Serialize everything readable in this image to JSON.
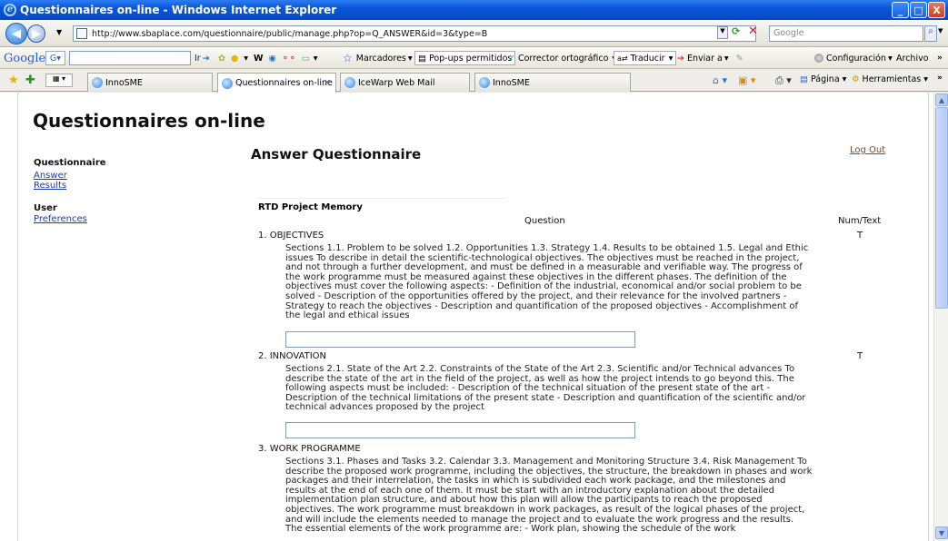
{
  "window": {
    "title": "Questionnaires on-line - Windows Internet Explorer",
    "minimize": "_",
    "maximize": "□",
    "close": "X"
  },
  "address": {
    "url": "http://www.sbaplace.com/questionnaire/public/manage.php?op=Q_ANSWER&id=3&type=B",
    "search_placeholder": "Google"
  },
  "google_toolbar": {
    "logo": "Google",
    "go": "Ir",
    "bookmarks": "Marcadores",
    "popups": "Pop-ups permitidos",
    "spell": "Corrector ortográfico",
    "translate": "Traducir",
    "send": "Enviar a",
    "settings": "Configuración",
    "archive": "Archivo"
  },
  "tabs": [
    {
      "label": "InnoSME"
    },
    {
      "label": "Questionnaires on-line"
    },
    {
      "label": "IceWarp Web Mail"
    },
    {
      "label": "InnoSME"
    }
  ],
  "tab_tools": {
    "page": "Página",
    "tools": "Herramientas"
  },
  "page": {
    "title": "Questionnaires on-line",
    "logout": "Log Out",
    "sidebar": {
      "questionnaire_head": "Questionnaire",
      "answer": "Answer",
      "results": "Results",
      "user_head": "User",
      "preferences": "Preferences"
    },
    "heading": "Answer Questionnaire",
    "section": "RTD Project Memory",
    "col_question": "Question",
    "col_type": "Num/Text",
    "questions": [
      {
        "title": "1. OBJECTIVES",
        "type": "T",
        "desc": "Sections 1.1. Problem to be solved 1.2. Opportunities 1.3. Strategy 1.4. Results to be obtained 1.5. Legal and Ethic issues To describe in detail the scientific-technological objectives. The objectives must be reached in the project, and not through a further development, and must be defined in a measurable and verifiable way. The progress of the work programme must be measured against these objectives in the different phases. The definition of the objectives must cover the following aspects: - Definition of the industrial, economical and/or social problem to be solved - Description of the opportunities offered by the project, and their relevance for the involved partners - Strategy to reach the objectives - Description and quantification of the proposed objectives - Accomplishment of the legal and ethical issues"
      },
      {
        "title": "2. INNOVATION",
        "type": "T",
        "desc": "Sections 2.1. State of the Art 2.2. Constraints of the State of the Art 2.3. Scientific and/or Technical advances To describe the state of the art in the field of the project, as well as how the project intends to go beyond this. The following aspects must be included: - Description of the technical situation of the present state of the art - Description of the technical limitations of the present state - Description and quantification of the scientific and/or technical advances proposed by the project"
      },
      {
        "title": "3. WORK PROGRAMME",
        "type": "T",
        "desc": "Sections 3.1. Phases and Tasks 3.2. Calendar 3.3. Management and Monitoring Structure 3.4. Risk Management To describe the proposed work programme, including the objectives, the structure, the breakdown in phases and work packages and their interrelation, the tasks in which is subdivided each work package, and the milestones and results at the end of each one of them. It must be start with an introductory explanation about the detailed implementation plan structure, and about how this plan will allow the participants to reach the proposed objectives. The work programme must breakdown in work packages, as result of the logical phases of the project, and will include the elements needed to manage the project and to evaluate the work progress and the results. The essential elements of the work programme are: - Work plan, showing the schedule of the work"
      }
    ]
  }
}
